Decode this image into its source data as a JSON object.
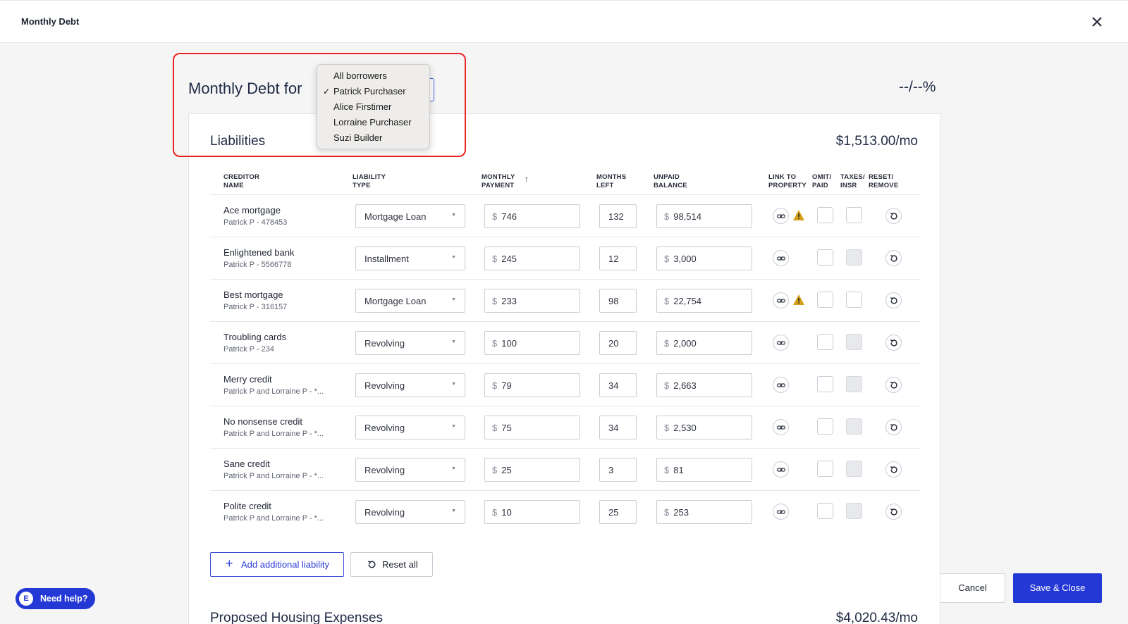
{
  "window": {
    "title": "Monthly Debt",
    "close_icon": "close-icon"
  },
  "header": {
    "heading": "Monthly Debt for",
    "ratio": "--/--%"
  },
  "borrower_select": {
    "options": [
      "All borrowers",
      "Patrick Purchaser",
      "Alice Firstimer",
      "Lorraine Purchaser",
      "Suzi Builder"
    ],
    "selected": "Patrick Purchaser",
    "check_glyph": "✓"
  },
  "liabilities": {
    "title": "Liabilities",
    "total": "$1,513.00/mo",
    "columns": {
      "creditor": [
        "CREDITOR",
        "NAME"
      ],
      "type": [
        "LIABILITY",
        "TYPE"
      ],
      "payment": [
        "MONTHLY",
        "PAYMENT"
      ],
      "months": [
        "MONTHS",
        "LEFT"
      ],
      "balance": [
        "UNPAID",
        "BALANCE"
      ],
      "link": [
        "LINK TO",
        "PROPERTY"
      ],
      "omit": [
        "OMIT/",
        "PAID"
      ],
      "taxes": [
        "TAXES/",
        "INSR"
      ],
      "reset": [
        "RESET/",
        "REMOVE"
      ]
    },
    "currency_symbol": "$",
    "rows": [
      {
        "name": "Ace mortgage",
        "sub": "Patrick P - 478453",
        "type": "Mortgage Loan",
        "payment": "746",
        "months": "132",
        "balance": "98,514",
        "warning": true,
        "taxes_enabled": true
      },
      {
        "name": "Enlightened bank",
        "sub": "Patrick P - 5566778",
        "type": "Installment",
        "payment": "245",
        "months": "12",
        "balance": "3,000",
        "warning": false,
        "taxes_enabled": false
      },
      {
        "name": "Best mortgage",
        "sub": "Patrick P - 316157",
        "type": "Mortgage Loan",
        "payment": "233",
        "months": "98",
        "balance": "22,754",
        "warning": true,
        "taxes_enabled": true
      },
      {
        "name": "Troubling cards",
        "sub": "Patrick P - 234",
        "type": "Revolving",
        "payment": "100",
        "months": "20",
        "balance": "2,000",
        "warning": false,
        "taxes_enabled": false
      },
      {
        "name": "Merry credit",
        "sub": "Patrick P and Lorraine P - *...",
        "type": "Revolving",
        "payment": "79",
        "months": "34",
        "balance": "2,663",
        "warning": false,
        "taxes_enabled": false
      },
      {
        "name": "No nonsense credit",
        "sub": "Patrick P and Lorraine P - *...",
        "type": "Revolving",
        "payment": "75",
        "months": "34",
        "balance": "2,530",
        "warning": false,
        "taxes_enabled": false
      },
      {
        "name": "Sane credit",
        "sub": "Patrick P and Lorraine P - *...",
        "type": "Revolving",
        "payment": "25",
        "months": "3",
        "balance": "81",
        "warning": false,
        "taxes_enabled": false
      },
      {
        "name": "Polite credit",
        "sub": "Patrick P and Lorraine P - *...",
        "type": "Revolving",
        "payment": "10",
        "months": "25",
        "balance": "253",
        "warning": false,
        "taxes_enabled": false
      }
    ],
    "add_button": "Add additional liability",
    "reset_all_button": "Reset all"
  },
  "proposed_housing": {
    "title": "Proposed Housing Expenses",
    "total": "$4,020.43/mo"
  },
  "footer": {
    "cancel": "Cancel",
    "save": "Save & Close"
  },
  "help": {
    "label": "Need help?",
    "logo_glyph": "E"
  },
  "colors": {
    "primary": "#2438d6",
    "highlight": "#e8261f",
    "warning": "#d4a017"
  }
}
